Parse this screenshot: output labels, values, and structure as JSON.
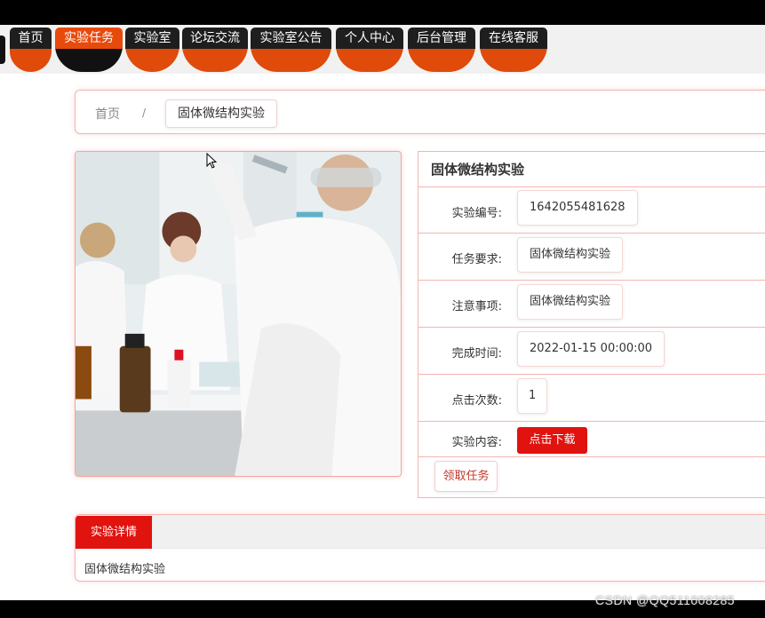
{
  "nav": {
    "items": [
      {
        "label": "首页"
      },
      {
        "label": "实验任务"
      },
      {
        "label": "实验室"
      },
      {
        "label": "论坛交流"
      },
      {
        "label": "实验室公告"
      },
      {
        "label": "个人中心"
      },
      {
        "label": "后台管理"
      },
      {
        "label": "在线客服"
      }
    ],
    "active_index": 1
  },
  "breadcrumb": {
    "home": "首页",
    "separator": "/",
    "current": "固体微结构实验"
  },
  "photo": {
    "icon": "lab-photo"
  },
  "info": {
    "title": "固体微结构实验",
    "rows": [
      {
        "label": "实验编号:",
        "value": "1642055481628"
      },
      {
        "label": "任务要求:",
        "value": "固体微结构实验"
      },
      {
        "label": "注意事项:",
        "value": "固体微结构实验"
      },
      {
        "label": "完成时间:",
        "value": "2022-01-15 00:00:00"
      },
      {
        "label": "点击次数:",
        "value": "1"
      }
    ],
    "content_label": "实验内容:",
    "download_label": "点击下载",
    "take_task_label": "领取任务"
  },
  "detail": {
    "tab_label": "实验详情",
    "content": "固体微结构实验"
  },
  "watermark": "CSDN @QQ511008285",
  "colors": {
    "accent": "#e0130f",
    "nav_orange": "#e04a0a",
    "border_pink": "#f2b5b1"
  }
}
